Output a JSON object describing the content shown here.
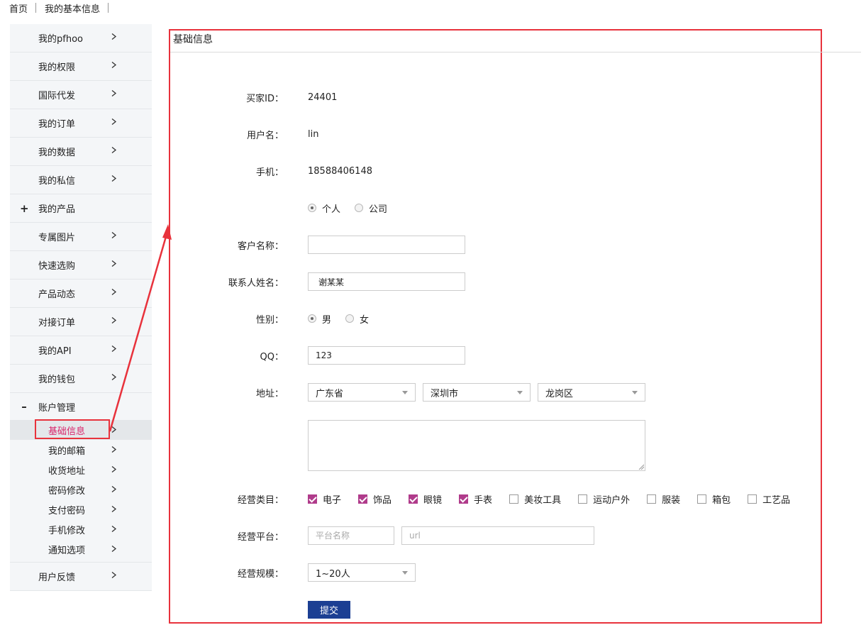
{
  "breadcrumb": {
    "home": "首页",
    "current": "我的基本信息"
  },
  "sidebar": {
    "items": [
      {
        "label": "我的pfhoo"
      },
      {
        "label": "我的权限"
      },
      {
        "label": "国际代发"
      },
      {
        "label": "我的订单"
      },
      {
        "label": "我的数据"
      },
      {
        "label": "我的私信"
      },
      {
        "label": "我的产品",
        "toggle": "+"
      },
      {
        "label": "专属图片"
      },
      {
        "label": "快速选购"
      },
      {
        "label": "产品动态"
      },
      {
        "label": "对接订单"
      },
      {
        "label": "我的API"
      },
      {
        "label": "我的钱包"
      },
      {
        "label": "账户管理",
        "toggle": "–"
      }
    ],
    "sub_items": [
      {
        "label": "基础信息",
        "active": true
      },
      {
        "label": "我的邮箱"
      },
      {
        "label": "收货地址"
      },
      {
        "label": "密码修改"
      },
      {
        "label": "支付密码"
      },
      {
        "label": "手机修改"
      },
      {
        "label": "通知选项"
      }
    ],
    "last_item": {
      "label": "用户反馈"
    }
  },
  "panel": {
    "title": "基础信息"
  },
  "form": {
    "buyer_id": {
      "label": "买家ID：",
      "value": "24401"
    },
    "username": {
      "label": "用户名：",
      "value": "lin"
    },
    "phone": {
      "label": "手机：",
      "value": "18588406148"
    },
    "account_type": {
      "options": [
        "个人",
        "公司"
      ],
      "selected": "个人"
    },
    "customer_name": {
      "label": "客户名称：",
      "value": ""
    },
    "contact_name": {
      "label": "联系人姓名：",
      "value": "谢某某"
    },
    "gender": {
      "label": "性别：",
      "options": [
        "男",
        "女"
      ],
      "selected": "男"
    },
    "qq": {
      "label": "QQ：",
      "value": "123"
    },
    "address": {
      "label": "地址：",
      "province": "广东省",
      "city": "深圳市",
      "district": "龙岗区",
      "detail": ""
    },
    "categories": {
      "label": "经营类目：",
      "items": [
        {
          "name": "电子",
          "checked": true
        },
        {
          "name": "饰品",
          "checked": true
        },
        {
          "name": "眼镜",
          "checked": true
        },
        {
          "name": "手表",
          "checked": true
        },
        {
          "name": "美妆工具",
          "checked": false
        },
        {
          "name": "运动户外",
          "checked": false
        },
        {
          "name": "服装",
          "checked": false
        },
        {
          "name": "箱包",
          "checked": false
        },
        {
          "name": "工艺品",
          "checked": false
        }
      ]
    },
    "platform": {
      "label": "经营平台：",
      "name_placeholder": "平台名称",
      "url_placeholder": "url"
    },
    "scale": {
      "label": "经营规模：",
      "value": "1~20人"
    },
    "submit_label": "提交"
  },
  "colors": {
    "annotation": "#e8323c",
    "submit": "#1c3f93",
    "checked": "#b03b8b",
    "active_text": "#d9266b"
  }
}
